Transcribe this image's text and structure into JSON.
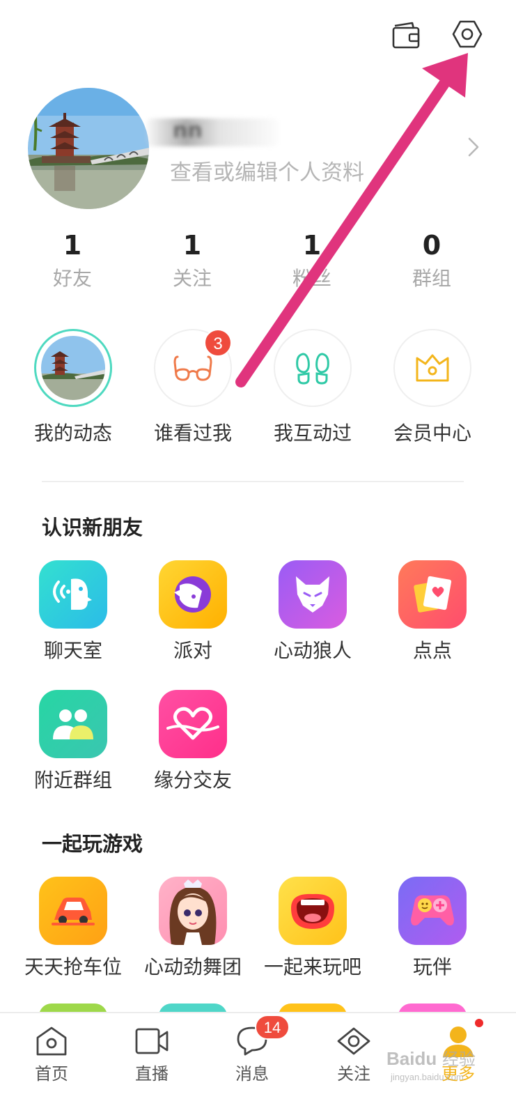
{
  "profile": {
    "name": "nn",
    "subtitle": "查看或编辑个人资料"
  },
  "stats": [
    {
      "value": "1",
      "label": "好友"
    },
    {
      "value": "1",
      "label": "关注"
    },
    {
      "value": "1",
      "label": "粉丝"
    },
    {
      "value": "0",
      "label": "群组"
    }
  ],
  "quick_actions": [
    {
      "label": "我的动态",
      "icon": "avatar-thumbnail-icon"
    },
    {
      "label": "谁看过我",
      "icon": "glasses-icon",
      "badge": "3"
    },
    {
      "label": "我互动过",
      "icon": "footprints-icon"
    },
    {
      "label": "会员中心",
      "icon": "crown-icon"
    }
  ],
  "sections": {
    "meet": {
      "title": "认识新朋友",
      "apps": [
        {
          "label": "聊天室",
          "icon": "voice-chat-icon",
          "color": "#29d3d8"
        },
        {
          "label": "派对",
          "icon": "party-face-icon",
          "color": "#ffc417"
        },
        {
          "label": "心动狼人",
          "icon": "wolf-icon",
          "color": "#b95cf0"
        },
        {
          "label": "点点",
          "icon": "heart-card-icon",
          "color": "#ff6a5a"
        },
        {
          "label": "附近群组",
          "icon": "group-people-icon",
          "color": "#2ed39a"
        },
        {
          "label": "缘分交友",
          "icon": "heart-ribbon-icon",
          "color": "#ff3f9f"
        }
      ]
    },
    "games": {
      "title": "一起玩游戏",
      "apps": [
        {
          "label": "天天抢车位",
          "icon": "car-icon",
          "color": "#ffb31a"
        },
        {
          "label": "心动劲舞团",
          "icon": "dancer-girl-icon",
          "color": "#ff9ab8"
        },
        {
          "label": "一起来玩吧",
          "icon": "open-mouth-icon",
          "color": "#ffd02a"
        },
        {
          "label": "玩伴",
          "icon": "gamepad-icon",
          "color": "#8f6cf5"
        }
      ]
    }
  },
  "bottom_nav": [
    {
      "label": "首页",
      "icon": "home-icon"
    },
    {
      "label": "直播",
      "icon": "video-camera-icon"
    },
    {
      "label": "消息",
      "icon": "chat-bubble-icon",
      "badge": "14"
    },
    {
      "label": "关注",
      "icon": "eye-icon"
    },
    {
      "label": "更多",
      "icon": "profile-person-icon",
      "active": true
    }
  ],
  "colors": {
    "accent": "#f3b41b",
    "badge": "#ef4b3d",
    "annotation_arrow": "#e0347d"
  }
}
